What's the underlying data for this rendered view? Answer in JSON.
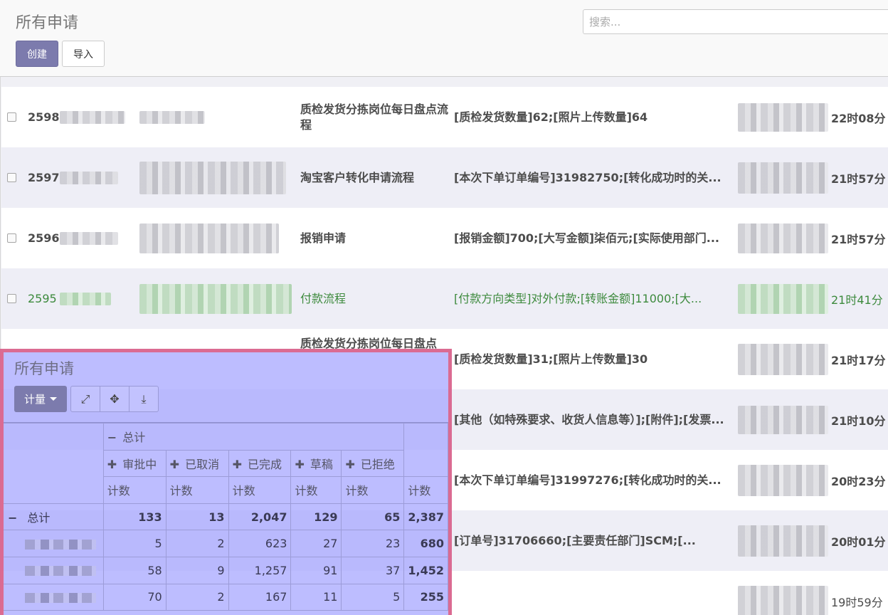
{
  "header": {
    "title": "所有申请",
    "search_placeholder": "搜索...",
    "create_label": "创建",
    "import_label": "导入"
  },
  "rows": [
    {
      "id": "2598",
      "workflow": "质检发货分拣岗位每日盘点流程",
      "description": "[质检发货数量]62;[照片上传数量]64",
      "duration": "22时08分"
    },
    {
      "id": "2597",
      "workflow": "淘宝客户转化申请流程",
      "description": "[本次下单订单编号]31982750;[转化成功时的关...",
      "duration": "21时57分"
    },
    {
      "id": "2596",
      "workflow": "报销申请",
      "description": "[报销金额]700;[大写金额]柒佰元;[实际使用部门...",
      "duration": "21时57分"
    },
    {
      "id": "2595",
      "workflow": "付款流程",
      "description": "[付款方向类型]对外付款;[转账金额]11000;[大...",
      "duration": "21时41分"
    },
    {
      "id": "",
      "workflow": "质检发货分拣岗位每日盘点",
      "description": "[质检发货数量]31;[照片上传数量]30",
      "duration": "21时17分"
    },
    {
      "id": "",
      "workflow": "",
      "description": "[其他（如特殊要求、收货人信息等）];[附件];[发票...",
      "duration": "21时10分"
    },
    {
      "id": "",
      "workflow": "",
      "description": "[本次下单订单编号]31997276;[转化成功时的关...",
      "duration": "20时23分"
    },
    {
      "id": "",
      "workflow": "",
      "description": "[订单号]31706660;[主要责任部门]SCM;[...",
      "duration": "20时01分"
    },
    {
      "id": "",
      "workflow": "",
      "description": "",
      "duration": "19时59分"
    }
  ],
  "pivot": {
    "title": "所有申请",
    "measure_button": "计量",
    "tools": [
      "expand-icon",
      "fullscreen-icon",
      "download-icon"
    ],
    "col_group_label": "总计",
    "columns": [
      "审批中",
      "已取消",
      "已完成",
      "草稿",
      "已拒绝"
    ],
    "measure_label": "计数",
    "total_row_label": "总计",
    "total_row": [
      "133",
      "13",
      "2,047",
      "129",
      "65",
      "2,387"
    ],
    "data_rows": [
      [
        "5",
        "2",
        "623",
        "27",
        "23",
        "680"
      ],
      [
        "58",
        "9",
        "1,257",
        "91",
        "37",
        "1,452"
      ],
      [
        "70",
        "2",
        "167",
        "11",
        "5",
        "255"
      ]
    ]
  }
}
